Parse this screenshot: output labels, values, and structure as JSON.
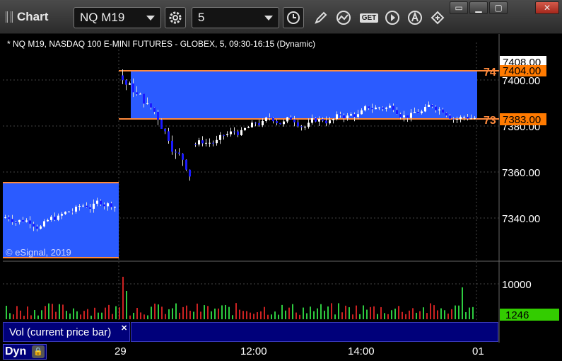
{
  "toolbar": {
    "title": "Chart",
    "symbol": "NQ M19",
    "interval": "5",
    "icons": [
      "settings-gear-icon",
      "clock-icon",
      "pencil-icon",
      "study-icon",
      "get-icon",
      "play-icon",
      "alert-icon",
      "link-icon"
    ],
    "get_label": "GET"
  },
  "window": {
    "btn_restore": "▭",
    "btn_minimize": "▁",
    "btn_maximize": "▢",
    "btn_close": "✕"
  },
  "chart": {
    "legend": "* NQ M19, NASDAQ 100 E-MINI FUTURES - GLOBEX, 5, 09:30-16:15 (Dynamic)",
    "watermark": "© eSignal, 2019",
    "price_labels": [
      "7400.00",
      "7380.00",
      "7360.00",
      "7340.00"
    ],
    "last_price": "7408.00",
    "upper_level": "7404.00",
    "lower_level": "7383.00",
    "upper_level_short": "74",
    "lower_level_short": "73",
    "volume_label": "10000",
    "current_volume": "1246",
    "volume_title": "Vol (current price bar)",
    "x_labels": [
      "29",
      "12:00",
      "14:00",
      "01"
    ],
    "dyn_label": "Dyn"
  },
  "colors": {
    "zone_fill": "#2b5bff",
    "level_line": "#ff8a3c",
    "last_price_bg": "#ffffff",
    "level_label_bg": "#ff7a00",
    "volume_up": "#2ecc40",
    "volume_down": "#cc2222",
    "current_volume_bg": "#33cc00"
  }
}
